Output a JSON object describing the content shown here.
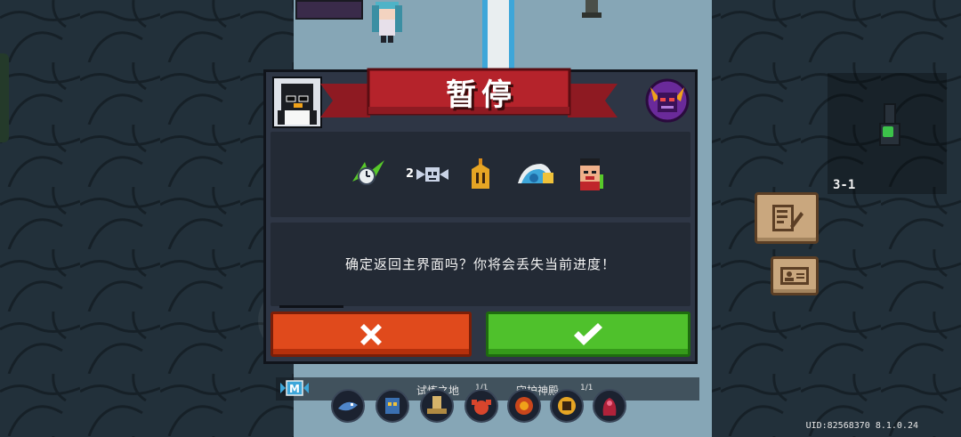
{
  "pause_dialog": {
    "title": "暂停",
    "message": "确定返回主界面吗？你将会丢失当前进度！",
    "cancel_icon": "cross-icon",
    "confirm_icon": "check-icon",
    "buffs": [
      {
        "icon": "speed-clock-buff-icon"
      },
      {
        "icon": "winged-skull-buff-icon",
        "count": "2"
      },
      {
        "icon": "spartan-helmet-buff-icon"
      },
      {
        "icon": "wave-shell-buff-icon"
      },
      {
        "icon": "rage-character-buff-icon"
      }
    ]
  },
  "minimap": {
    "level": "3-1"
  },
  "side_buttons": [
    "notes-icon",
    "id-card-icon"
  ],
  "tasks": [
    {
      "label": "试炼之地",
      "count": "1/1"
    },
    {
      "label": "守护神殿",
      "count": "1/1"
    }
  ],
  "mode_badge": "M",
  "footer": {
    "uid": "UID:82568370 8.1.0.24"
  },
  "colors": {
    "cancel": "#e04a1c",
    "confirm": "#4fc12c",
    "ribbon": "#b5232b",
    "panel": "#2e3645",
    "floor": "#86a6b6"
  }
}
